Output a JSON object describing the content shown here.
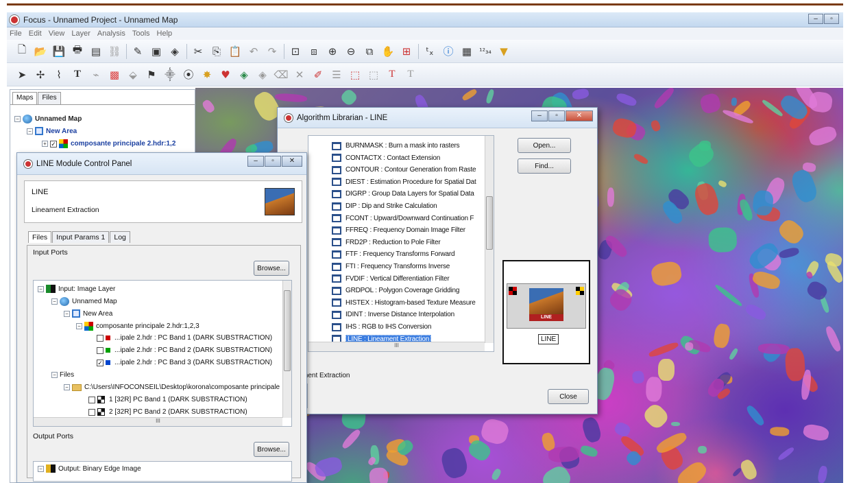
{
  "app": {
    "title": "Focus - Unnamed Project - Unnamed Map",
    "menu": [
      "File",
      "Edit",
      "View",
      "Layer",
      "Analysis",
      "Tools",
      "Help"
    ]
  },
  "left_panel": {
    "tabs": [
      "Maps",
      "Files"
    ],
    "tree": {
      "map": "Unnamed Map",
      "area": "New Area",
      "layer": "composante principale 2.hdr:1,2"
    }
  },
  "control_panel": {
    "title": "LINE Module Control Panel",
    "module_name": "LINE",
    "module_desc": "Lineament Extraction",
    "tabs": [
      "Files",
      "Input Params 1",
      "Log"
    ],
    "input_ports_label": "Input Ports",
    "browse_label": "Browse...",
    "input_tree": {
      "input_label": "Input: Image Layer",
      "map": "Unnamed Map",
      "area": "New Area",
      "layer": "composante principale 2.hdr:1,2,3",
      "bands": [
        {
          "label": "...ipale 2.hdr : PC Band 1 (DARK SUBSTRACTION)",
          "checked": false,
          "color": "#cc0000"
        },
        {
          "label": "...ipale 2.hdr : PC Band 2 (DARK SUBSTRACTION)",
          "checked": false,
          "color": "#00a000"
        },
        {
          "label": "...ipale 2.hdr : PC Band 3 (DARK SUBSTRACTION)",
          "checked": true,
          "color": "#0044cc"
        }
      ],
      "files_label": "Files",
      "folder": "C:\\Users\\INFOCONSEIL\\Desktop\\korona\\composante principale",
      "files": [
        "1 [32R] PC Band 1 (DARK SUBSTRACTION)",
        "2 [32R] PC Band 2 (DARK SUBSTRACTION)"
      ],
      "hscroll_mark": "III"
    },
    "output_ports_label": "Output Ports",
    "output_browse_label": "Browse...",
    "output_first": "Output: Binary Edge Image"
  },
  "algorithm_librarian": {
    "title": "Algorithm Librarian - LINE",
    "items": [
      "BURNMASK : Burn a mask into rasters",
      "CONTACTX : Contact Extension",
      "CONTOUR : Contour Generation from Raste",
      "DIEST : Estimation Procedure for Spatial Dat",
      "DIGRP : Group Data Layers for Spatial Data",
      "DIP : Dip and Strike Calculation",
      "FCONT : Upward/Downward Continuation F",
      "FFREQ : Frequency Domain Image Filter",
      "FRD2P : Reduction to Pole Filter",
      "FTF : Frequency Transforms Forward",
      "FTI : Frequency Transforms Inverse",
      "FVDIF : Vertical Differentiation Filter",
      "GRDPOL : Polygon Coverage Gridding",
      "HISTEX : Histogram-based Texture Measure",
      "IDINT : Inverse Distance Interpolation",
      "IHS : RGB to IHS Conversion",
      "LINE : Lineament Extraction"
    ],
    "selected_index": 16,
    "open_label": "Open...",
    "find_label": "Find...",
    "preview_label": "LINE",
    "preview_icon_label": "LINE",
    "description": "ment Extraction",
    "close_label": "Close",
    "hscroll_mark": "III"
  },
  "colors": {
    "accent": "#3b7de0",
    "title_gradient_top": "#dce9f7",
    "banner_rule": "#7a3a12"
  }
}
